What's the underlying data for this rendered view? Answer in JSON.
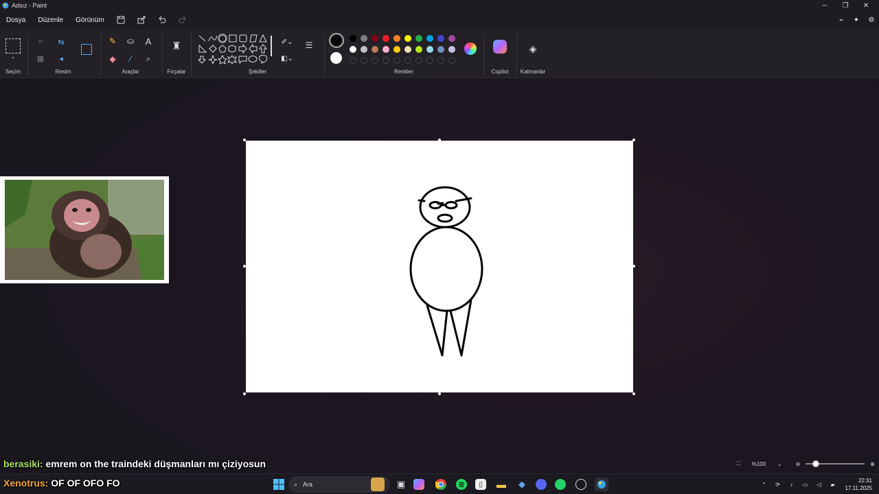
{
  "window": {
    "title": "Adsız - Paint"
  },
  "menu": {
    "items": [
      "Dosya",
      "Düzenle",
      "Görünüm"
    ]
  },
  "ribbon": {
    "groups": {
      "selection": "Seçim",
      "image": "Resim",
      "tools": "Araçlar",
      "brushes": "Fırçalar",
      "shapes": "Şekiller",
      "colors": "Renkler",
      "copilot": "Copilot",
      "layers": "Katmanlar"
    },
    "palette_row1": [
      "#000000",
      "#7f7f7f",
      "#880015",
      "#ed1c24",
      "#ff7f27",
      "#fff200",
      "#22b14c",
      "#00a2e8",
      "#3f48cc",
      "#a349a4"
    ],
    "palette_row2": [
      "#ffffff",
      "#c3c3c3",
      "#b97a57",
      "#ffaec9",
      "#ffc90e",
      "#efe4b0",
      "#b5e61d",
      "#99d9ea",
      "#7092be",
      "#c8bfe7"
    ],
    "primary_color": "#000000",
    "secondary_color": "#ffffff"
  },
  "status": {
    "zoom": "%100"
  },
  "chat": [
    {
      "user": "berasiki:",
      "message": "emrem on the traindeki düşmanları mı çiziyosun"
    },
    {
      "user": "Xenotrus:",
      "message": "OF OF OFO FO"
    }
  ],
  "taskbar": {
    "search_placeholder": "Ara",
    "time": "22:31",
    "date": "17.11.2025"
  }
}
